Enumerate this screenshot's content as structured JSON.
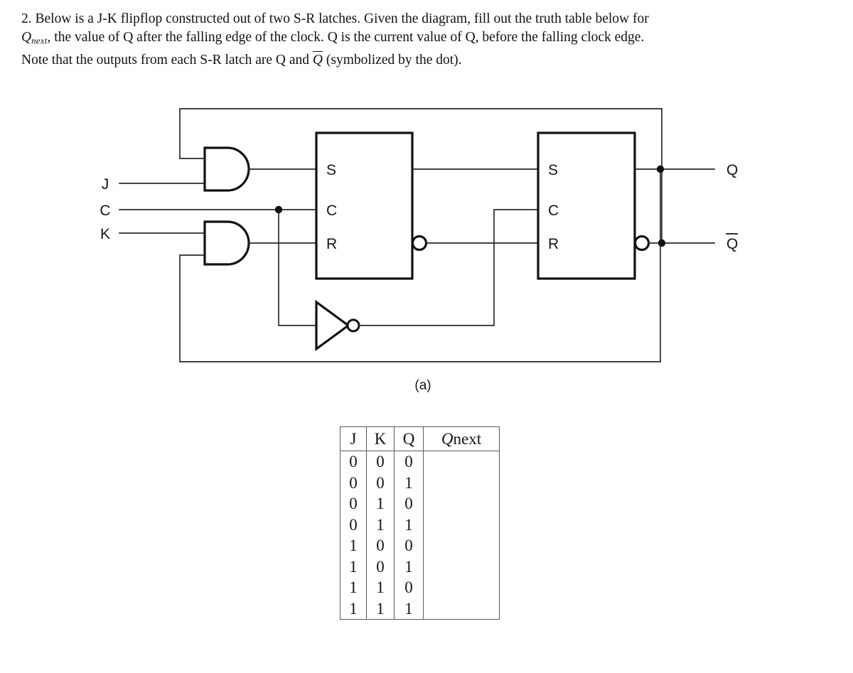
{
  "problem": {
    "lines": [
      "2. Below is a J-K flipflop constructed out of two S-R latches. Given the diagram, fill out the truth table below for",
      "the value of Q after the falling edge of the clock.  Q is the current value of Q, before the falling clock edge.",
      "Note that the outputs from each S-R latch are Q and"
    ],
    "line2_lead_symbol": "Q",
    "line2_lead_sub": "next",
    "line2_lead_tail": ",",
    "line3_overline_symbol": "Q",
    "line3_tail": "(symbolized by the dot)."
  },
  "diagram": {
    "caption": "(a)",
    "inputs": [
      {
        "name": "j-input-label",
        "label": "J"
      },
      {
        "name": "clock-input-label",
        "label": "C"
      },
      {
        "name": "k-input-label",
        "label": "K"
      }
    ],
    "outputs": [
      {
        "name": "q-output-label",
        "label": "Q",
        "overline": false
      },
      {
        "name": "qbar-output-label",
        "label": "Q",
        "overline": true
      }
    ],
    "latch_left": {
      "title": "left-sr-latch",
      "pins": [
        "S",
        "C",
        "R"
      ]
    },
    "latch_right": {
      "title": "right-sr-latch",
      "pins": [
        "S",
        "C",
        "R"
      ]
    },
    "gates": [
      {
        "name": "and-gate-upper",
        "type": "AND"
      },
      {
        "name": "and-gate-lower",
        "type": "AND"
      },
      {
        "name": "not-gate",
        "type": "NOT"
      }
    ],
    "colors": {
      "wire": "#2a2a2a",
      "body": "#111111",
      "background": "#ffffff"
    }
  },
  "truth_table": {
    "headers": [
      "J",
      "K",
      "Q",
      "Q"
    ],
    "header_qnext_sub": "next",
    "rows": [
      [
        "0",
        "0",
        "0",
        ""
      ],
      [
        "0",
        "0",
        "1",
        ""
      ],
      [
        "0",
        "1",
        "0",
        ""
      ],
      [
        "0",
        "1",
        "1",
        ""
      ],
      [
        "1",
        "0",
        "0",
        ""
      ],
      [
        "1",
        "0",
        "1",
        ""
      ],
      [
        "1",
        "1",
        "0",
        ""
      ],
      [
        "1",
        "1",
        "1",
        ""
      ]
    ]
  }
}
